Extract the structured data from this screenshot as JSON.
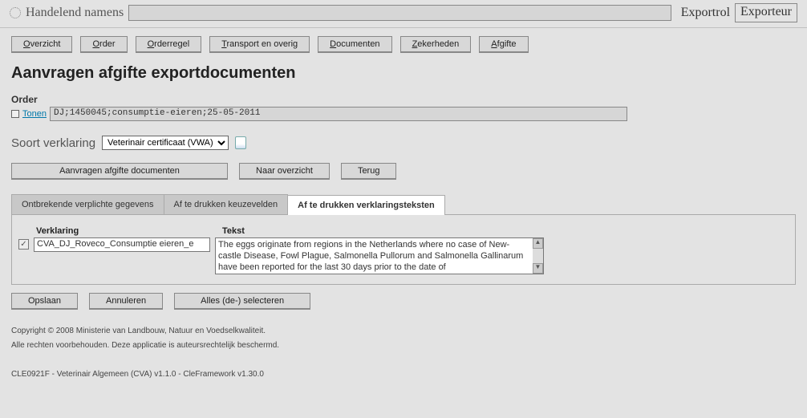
{
  "topbar": {
    "label": "Handelend namens",
    "input_value": "",
    "right_label": "Exportrol",
    "right_box": "Exporteur"
  },
  "menu": {
    "overzicht": "Overzicht",
    "order": "Order",
    "orderregel": "Orderregel",
    "transport": "Transport en overig",
    "documenten": "Documenten",
    "zekerheden": "Zekerheden",
    "afgifte": "Afgifte"
  },
  "page_title": "Aanvragen afgifte exportdocumenten",
  "order": {
    "heading": "Order",
    "tonen_link": "Tonen",
    "value": "DJ;1450045;consumptie-eieren;25-05-2011"
  },
  "soort": {
    "label": "Soort verklaring",
    "selected": "Veterinair certificaat (VWA)"
  },
  "actions": {
    "aanvragen": "Aanvragen afgifte documenten",
    "naar_overzicht": "Naar overzicht",
    "terug": "Terug"
  },
  "tabs": {
    "t1": "Ontbrekende verplichte gegevens",
    "t2": "Af te drukken keuzevelden",
    "t3": "Af te drukken verklaringsteksten"
  },
  "grid": {
    "col_verklaring": "Verklaring",
    "col_tekst": "Tekst",
    "rows": [
      {
        "checked": true,
        "verklaring": "CVA_DJ_Roveco_Consumptie eieren_e",
        "tekst": "The eggs originate from regions in the Netherlands where no case of New-castle Disease, Fowl Plague, Salmonella Pullorum and Salmonella Gallinarum have been reported for the last 30 days prior to the date of"
      }
    ]
  },
  "bottom": {
    "opslaan": "Opslaan",
    "annuleren": "Annuleren",
    "alles": "Alles (de-) selecteren"
  },
  "footer": {
    "line1": "Copyright © 2008 Ministerie van Landbouw, Natuur en Voedselkwaliteit.",
    "line2": "Alle rechten voorbehouden. Deze applicatie is auteursrechtelijk beschermd.",
    "line3": "CLE0921F - Veterinair Algemeen (CVA) v1.1.0 - CleFramework v1.30.0"
  }
}
